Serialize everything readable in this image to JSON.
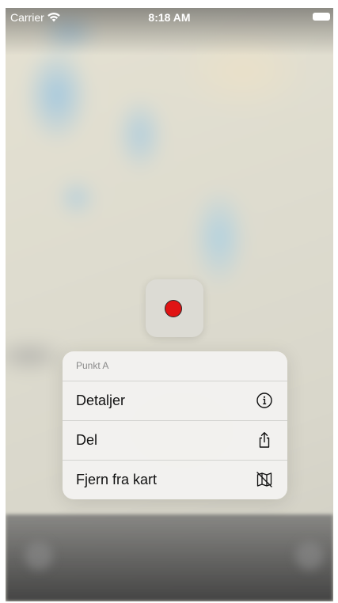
{
  "status_bar": {
    "carrier": "Carrier",
    "time": "8:18 AM"
  },
  "pin": {
    "color": "#e01414"
  },
  "context_menu": {
    "title": "Punkt A",
    "items": [
      {
        "label": "Detaljer",
        "icon": "info-icon"
      },
      {
        "label": "Del",
        "icon": "share-icon"
      },
      {
        "label": "Fjern fra kart",
        "icon": "map-remove-icon"
      }
    ]
  }
}
